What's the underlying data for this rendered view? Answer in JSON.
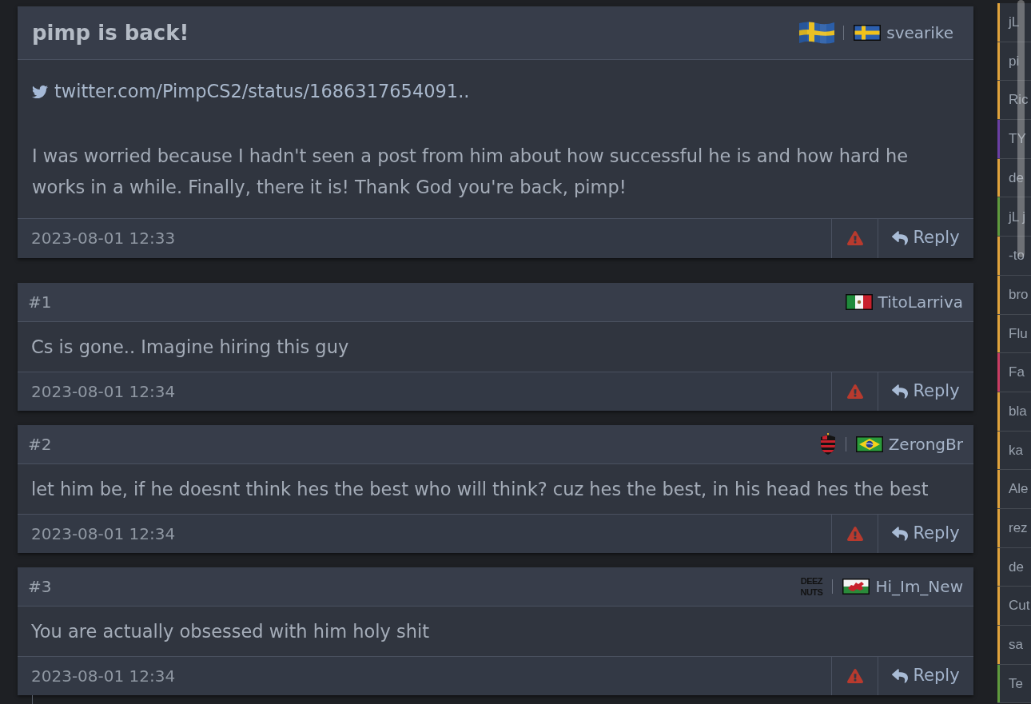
{
  "post": {
    "title": "pimp is back!",
    "emblems": [
      {
        "kind": "sweden-flag-waving"
      }
    ],
    "flag": {
      "kind": "sweden"
    },
    "author": "svearike",
    "link": "twitter.com/PimpCS2/status/1686317654091..",
    "body": "I was worried because I hadn't seen a post from him about how successful he is and how hard he works in a while. Finally, there it is! Thank God you're back, pimp!",
    "time": "2023-08-01 12:33",
    "reply": "Reply"
  },
  "comments": [
    {
      "number": "#1",
      "flag": {
        "kind": "mexico"
      },
      "author": "TitoLarriva",
      "text": "Cs is gone.. Imagine hiring this guy",
      "time": "2023-08-01 12:34",
      "reply": "Reply"
    },
    {
      "number": "#2",
      "emblems": [
        {
          "kind": "club-crest"
        }
      ],
      "flag": {
        "kind": "brazil"
      },
      "author": "ZerongBr",
      "text": "let him be, if he doesnt think hes the best who will think? cuz hes the best, in his head hes the best",
      "time": "2023-08-01 12:34",
      "reply": "Reply"
    },
    {
      "number": "#3",
      "emblems": [
        {
          "kind": "text-logo",
          "text": "DEEZ NUTS"
        }
      ],
      "flag": {
        "kind": "wales"
      },
      "author": "Hi_Im_New",
      "text": "You are actually obsessed with him holy shit",
      "time": "2023-08-01 12:34",
      "reply": "Reply"
    }
  ],
  "sidebar": {
    "items": [
      {
        "label": "jL",
        "color": "#e1a33c"
      },
      {
        "label": "pi",
        "color": "#e1a33c"
      },
      {
        "label": "Ric",
        "color": "#e1a33c"
      },
      {
        "label": "TY",
        "color": "#6a3fa3"
      },
      {
        "label": "de",
        "color": "#e1a33c"
      },
      {
        "label": "jL j",
        "color": "#5f9a3d"
      },
      {
        "label": "-to",
        "color": "#e1a33c"
      },
      {
        "label": "bro",
        "color": "#e1a33c"
      },
      {
        "label": "Flu",
        "color": "#e1a33c"
      },
      {
        "label": "Fa",
        "color": "#c93d63"
      },
      {
        "label": "bla",
        "color": "#e1a33c"
      },
      {
        "label": "ka",
        "color": "#e1a33c"
      },
      {
        "label": "Ale",
        "color": "#e1a33c"
      },
      {
        "label": "rez",
        "color": "#e1a33c"
      },
      {
        "label": "de",
        "color": "#e1a33c"
      },
      {
        "label": "Cut",
        "color": "#e1a33c"
      },
      {
        "label": "sa",
        "color": "#e1a33c"
      },
      {
        "label": "Te",
        "color": "#5f9a3d"
      }
    ]
  }
}
